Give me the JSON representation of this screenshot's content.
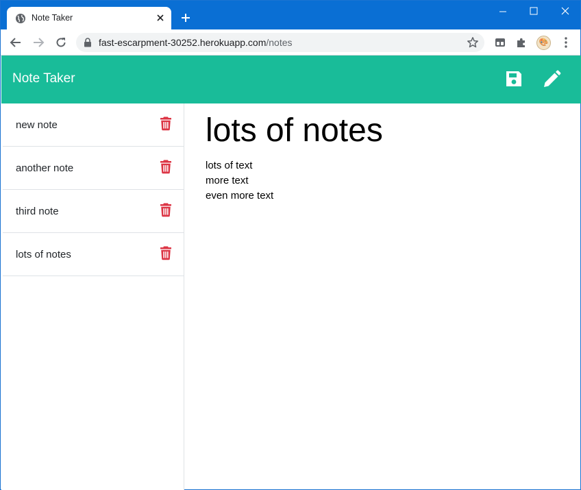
{
  "browser": {
    "tab_title": "Note Taker",
    "url_host": "fast-escarpment-30252.herokuapp.com",
    "url_path": "/notes",
    "avatar_label": "🎨"
  },
  "app": {
    "brand": "Note Taker",
    "accent_color": "#19bc99",
    "delete_color": "#dc3545",
    "icons": {
      "save": "save-icon",
      "write": "pencil-icon",
      "delete": "trash-icon"
    }
  },
  "notes": [
    {
      "title": "new note"
    },
    {
      "title": "another note"
    },
    {
      "title": "third note"
    },
    {
      "title": "lots of notes"
    }
  ],
  "active_note": {
    "title": "lots of notes",
    "text": "lots of text\nmore text\neven more text"
  }
}
